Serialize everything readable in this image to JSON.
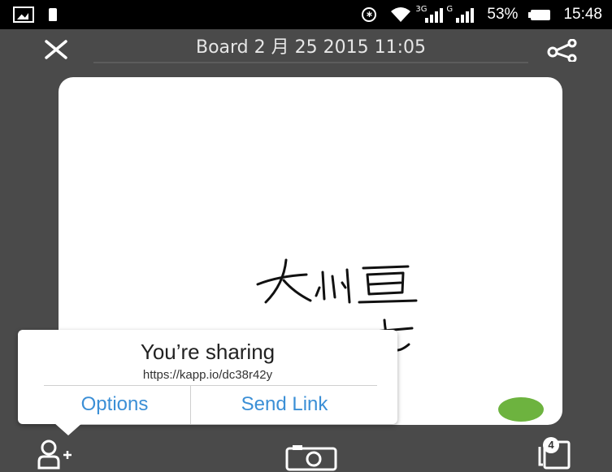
{
  "status_bar": {
    "network_type": "3G",
    "signal_tag_2": "G",
    "battery_percent": "53%",
    "time": "15:48",
    "icons": [
      "gallery-icon",
      "sd-card-icon",
      "bluetooth-icon",
      "wifi-icon",
      "signal-3g-icon",
      "signal-g-icon",
      "battery-icon"
    ]
  },
  "header": {
    "title": "Board 2 月 25 2015 11:05",
    "close_icon": "close-icon",
    "share_icon": "share-icon"
  },
  "canvas": {
    "handwriting_line1": "大小恒",
    "handwriting_line2": "smart",
    "background": "#ffffff",
    "color_swatch": "#6db33f"
  },
  "share_popup": {
    "title": "You’re sharing",
    "url": "https://kapp.io/dc38r42y",
    "options_label": "Options",
    "send_link_label": "Send Link",
    "accent": "#3b8fd6"
  },
  "toolbar": {
    "add_user_icon": "add-user-icon",
    "camera_icon": "camera-icon",
    "pages_icon": "pages-icon",
    "pages_count": "4"
  }
}
